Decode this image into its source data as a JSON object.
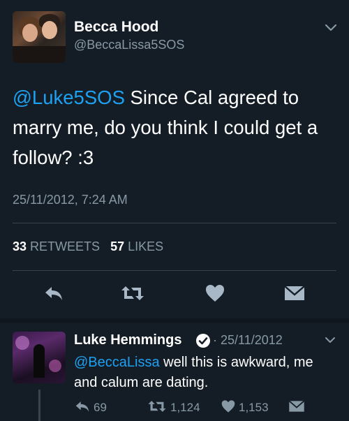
{
  "tweet": {
    "author_name": "Becca Hood",
    "author_handle": "@BeccaLissa5SOS",
    "mention": "@Luke5SOS",
    "body": " Since Cal agreed to marry me,  do you think I could get a follow? :3",
    "timestamp": "25/11/2012, 7:24 AM",
    "retweets_count": "33",
    "retweets_label": "RETWEETS",
    "likes_count": "57",
    "likes_label": "LIKES"
  },
  "reply": {
    "author_name": "Luke Hemmings",
    "meta": "· 25/11/2012",
    "mention": "@BeccaLissa",
    "body": " well this is awkward, me and calum are dating.",
    "retweets": "1,124",
    "likes": "1,153",
    "replies": "69"
  },
  "icons": {
    "reply": "reply-icon",
    "retweet": "retweet-icon",
    "like": "heart-icon",
    "dm": "envelope-icon",
    "menu": "chevron-down-icon",
    "verified": "verified-badge-icon"
  },
  "colors": {
    "background": "#141d26",
    "link": "#1da1f2",
    "secondary": "#8899a6",
    "divider": "#38444d",
    "icon": "#a8b8c6"
  }
}
